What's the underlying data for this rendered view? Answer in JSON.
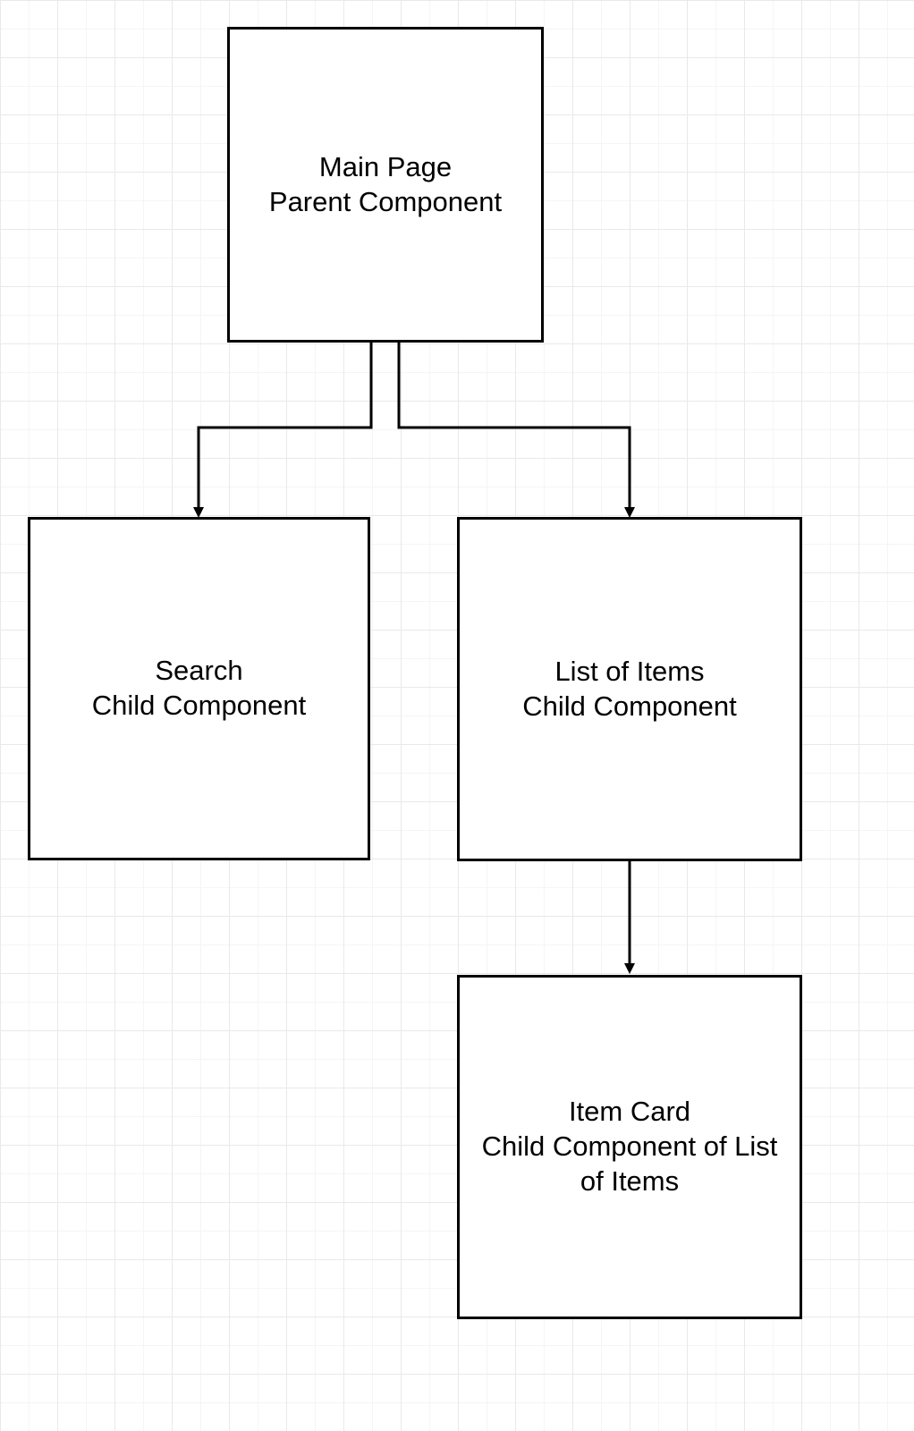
{
  "diagram": {
    "nodes": {
      "main_page": {
        "line1": "Main Page",
        "line2": "Parent Component"
      },
      "search": {
        "line1": "Search",
        "line2": "Child Component"
      },
      "list_of_items": {
        "line1": "List of Items",
        "line2": "Child Component"
      },
      "item_card": {
        "line1": "Item Card",
        "line2": "Child Component of List of Items"
      }
    },
    "edges": [
      {
        "from": "main_page",
        "to": "search"
      },
      {
        "from": "main_page",
        "to": "list_of_items"
      },
      {
        "from": "list_of_items",
        "to": "item_card"
      }
    ],
    "colors": {
      "stroke": "#000000",
      "background": "#ffffff",
      "grid_major": "#e9e9e9",
      "grid_minor": "#f5f5f5"
    }
  }
}
